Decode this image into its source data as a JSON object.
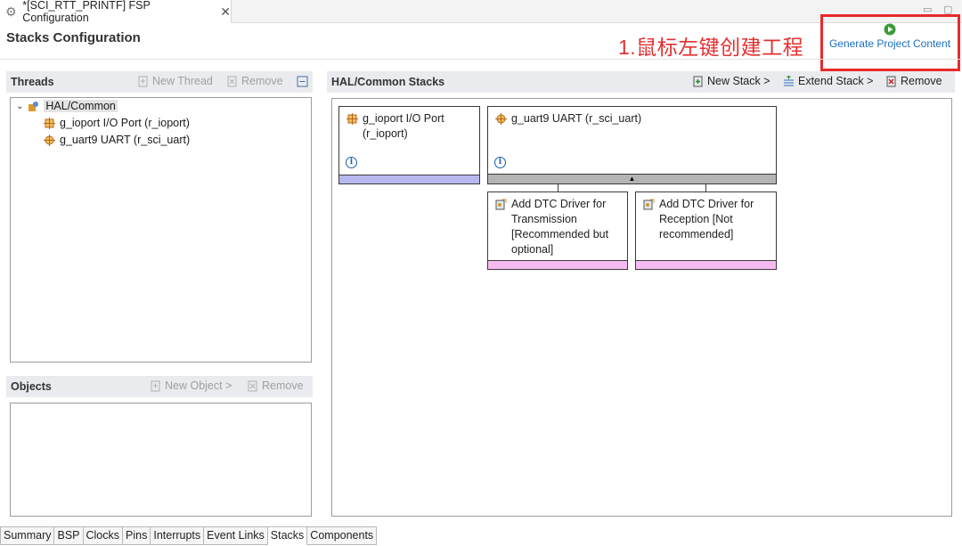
{
  "editor_tab": {
    "title": "*[SCI_RTT_PRINTF] FSP Configuration",
    "close": "✕"
  },
  "window_controls": {
    "minimize": "▭",
    "maximize": "▢"
  },
  "page_title": "Stacks Configuration",
  "annotation": "1.鼠标左键创建工程",
  "generate": {
    "label": "Generate Project Content",
    "icon": "green-play-icon"
  },
  "threads": {
    "title": "Threads",
    "new_thread": "New Thread",
    "remove": "Remove",
    "tree": {
      "root": "HAL/Common",
      "children": [
        "g_ioport I/O Port (r_ioport)",
        "g_uart9 UART (r_sci_uart)"
      ]
    }
  },
  "objects": {
    "title": "Objects",
    "new_object": "New Object >",
    "remove": "Remove"
  },
  "stacks": {
    "title": "HAL/Common Stacks",
    "new_stack": "New Stack >",
    "extend_stack": "Extend Stack >",
    "remove": "Remove",
    "cards": [
      {
        "title": "g_ioport I/O Port (r_ioport)",
        "info": "i"
      },
      {
        "title": "g_uart9 UART (r_sci_uart)",
        "info": "i",
        "collapse": "▲"
      }
    ],
    "sub_cards": [
      {
        "title": "Add DTC Driver for Transmission [Recommended but optional]"
      },
      {
        "title": "Add DTC Driver for Reception [Not recommended]"
      }
    ]
  },
  "bottom_tabs": [
    "Summary",
    "BSP",
    "Clocks",
    "Pins",
    "Interrupts",
    "Event Links",
    "Stacks",
    "Components"
  ],
  "colors": {
    "accent_red": "#e82a2a",
    "link_blue": "#1e6fc0",
    "module_bar": "#b8b8f0",
    "dtc_bar": "#f6baf2"
  }
}
